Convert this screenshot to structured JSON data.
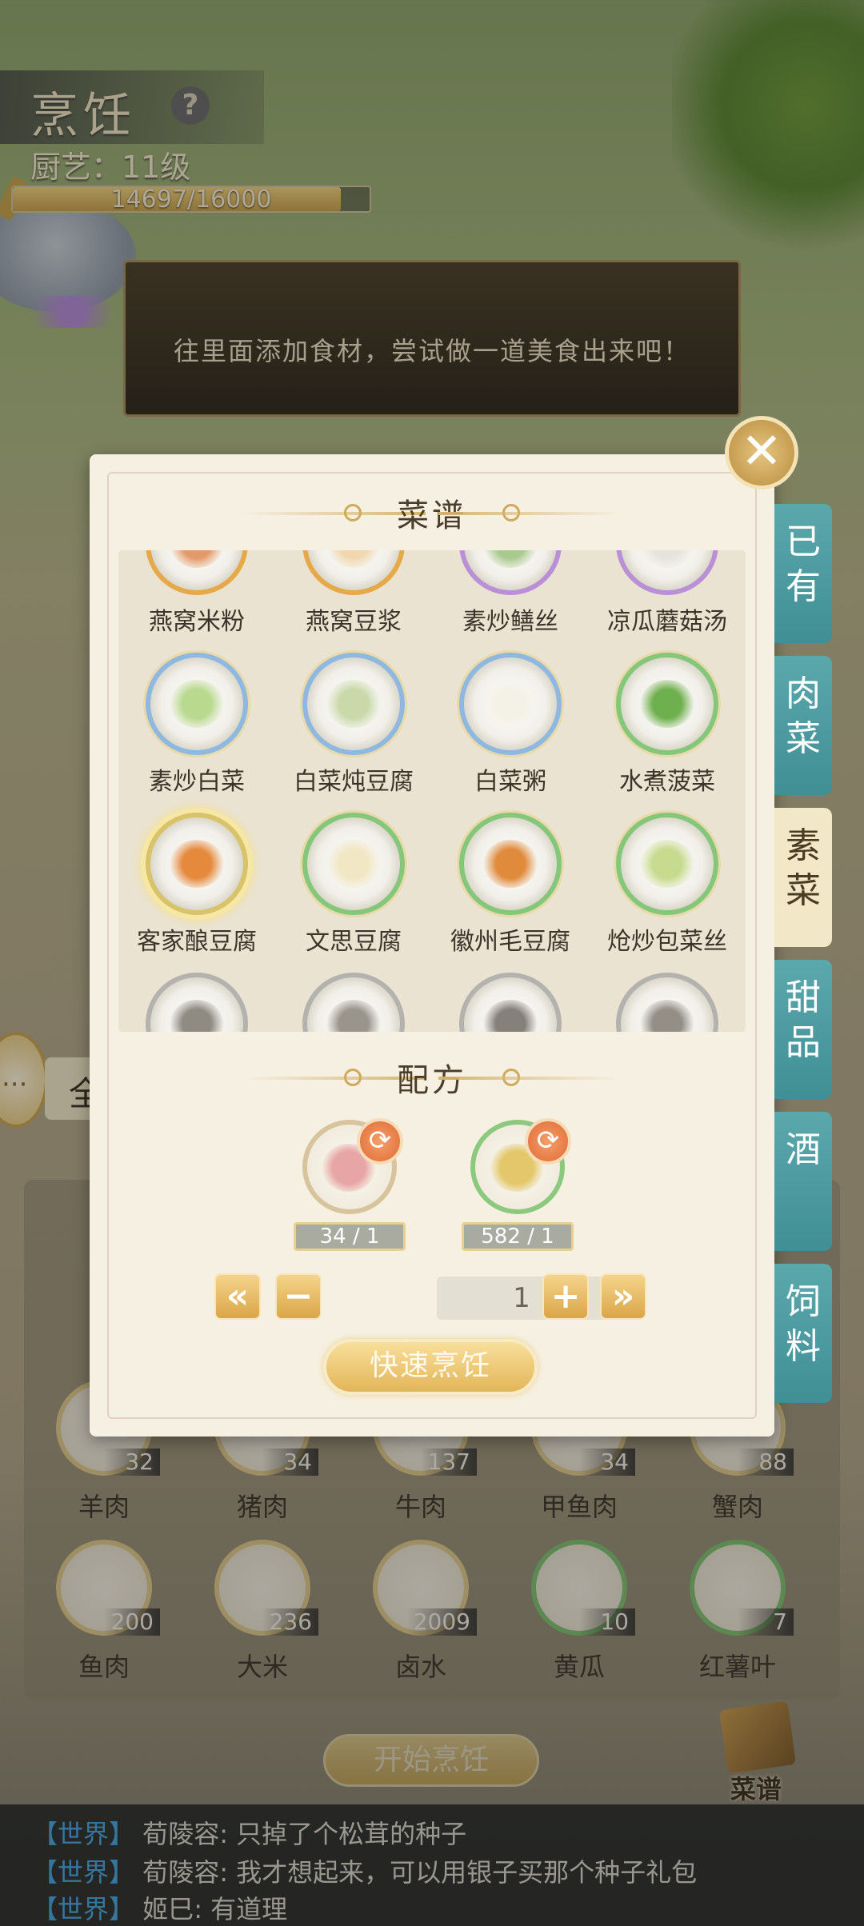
{
  "header": {
    "title": "烹饪",
    "help": "?",
    "skill_level": "厨艺：11级",
    "xp_text": "14697/16000",
    "xp_fraction": 0.92
  },
  "hint": "往里面添加食材，尝试做一道美食出来吧！",
  "modal": {
    "recipe_title": "菜谱",
    "formula_title": "配方",
    "close": "✕",
    "recipes": [
      {
        "name": "燕窝米粉",
        "ring": "orange",
        "food": "#e39a6b"
      },
      {
        "name": "燕窝豆浆",
        "ring": "orange",
        "food": "#f0d7b0"
      },
      {
        "name": "素炒鳝丝",
        "ring": "purple",
        "food": "#a9c98f"
      },
      {
        "name": "凉瓜蘑菇汤",
        "ring": "purple",
        "food": "#e6e2dc"
      },
      {
        "name": "素炒白菜",
        "ring": "blue",
        "food": "#b9d98e"
      },
      {
        "name": "白菜炖豆腐",
        "ring": "blue",
        "food": "#c9d9a9"
      },
      {
        "name": "白菜粥",
        "ring": "blue",
        "food": "#f4f1e6"
      },
      {
        "name": "水煮菠菜",
        "ring": "green",
        "food": "#6fb04e"
      },
      {
        "name": "客家酿豆腐",
        "ring": "gold",
        "food": "#e58a3d"
      },
      {
        "name": "文思豆腐",
        "ring": "green",
        "food": "#f1e7c4"
      },
      {
        "name": "徽州毛豆腐",
        "ring": "green",
        "food": "#e08a3b"
      },
      {
        "name": "炝炒包菜丝",
        "ring": "green",
        "food": "#c7db8f"
      },
      {
        "name": "",
        "ring": "gray",
        "food": "#8f8a82"
      },
      {
        "name": "",
        "ring": "gray",
        "food": "#9a958c"
      },
      {
        "name": "",
        "ring": "gray",
        "food": "#85807a"
      },
      {
        "name": "",
        "ring": "gray",
        "food": "#938e86"
      }
    ],
    "ingredients": [
      {
        "count": "34 / 1",
        "ring": "gold",
        "food": "#e8a5a5",
        "swap": "⟳"
      },
      {
        "count": "582 / 1",
        "ring": "green",
        "food": "#e3c76a",
        "swap": "⟳"
      }
    ],
    "qty_first": "«",
    "qty_minus": "−",
    "qty_value": "1",
    "qty_plus": "+",
    "qty_last": "»",
    "quick_cook": "快速烹饪"
  },
  "categories": [
    {
      "label": "已有",
      "active": false
    },
    {
      "label": "肉菜",
      "active": false
    },
    {
      "label": "素菜",
      "active": true
    },
    {
      "label": "甜品",
      "active": false
    },
    {
      "label": "酒",
      "active": false
    },
    {
      "label": "饲料",
      "active": false
    }
  ],
  "left_tab": "全",
  "inventory": [
    {
      "name": "羊肉",
      "count": "32",
      "ring": "gold"
    },
    {
      "name": "猪肉",
      "count": "34",
      "ring": "gold"
    },
    {
      "name": "牛肉",
      "count": "137",
      "ring": "gold"
    },
    {
      "name": "甲鱼肉",
      "count": "34",
      "ring": "gold"
    },
    {
      "name": "蟹肉",
      "count": "88",
      "ring": "gold"
    },
    {
      "name": "鱼肉",
      "count": "200",
      "ring": "gold"
    },
    {
      "name": "大米",
      "count": "236",
      "ring": "gold"
    },
    {
      "name": "卤水",
      "count": "2009",
      "ring": "gold"
    },
    {
      "name": "黄瓜",
      "count": "10",
      "ring": "green"
    },
    {
      "name": "红薯叶",
      "count": "7",
      "ring": "green"
    }
  ],
  "start_cook": "开始烹饪",
  "recipe_book": "菜谱",
  "chat": [
    {
      "tag": "【世界】",
      "msg": "荀陵容: 只掉了个松茸的种子"
    },
    {
      "tag": "【世界】",
      "msg": "荀陵容: 我才想起来，可以用银子买那个种子礼包"
    },
    {
      "tag": "【世界】",
      "msg": "姬巳: 有道理"
    }
  ]
}
